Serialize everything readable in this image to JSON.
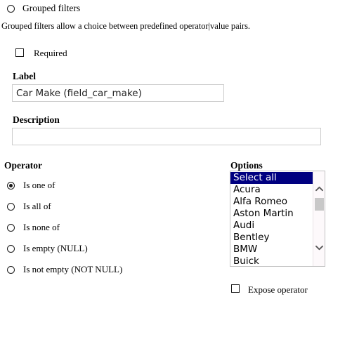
{
  "form": {
    "type_option": {
      "label": "Grouped filters",
      "selected": false,
      "icon": "radio-icon"
    },
    "help_text": "Grouped filters allow a choice between predefined operator|value pairs.",
    "required": {
      "label": "Required",
      "checked": false,
      "icon": "checkbox-icon"
    },
    "label_field": {
      "label": "Label",
      "value": "Car Make (field_car_make)",
      "placeholder": ""
    },
    "description_field": {
      "label": "Description",
      "value": "",
      "placeholder": ""
    },
    "operator": {
      "label": "Operator",
      "selected_index": 0,
      "options": [
        {
          "label": "Is one of"
        },
        {
          "label": "Is all of"
        },
        {
          "label": "Is none of"
        },
        {
          "label": "Is empty (NULL)"
        },
        {
          "label": "Is not empty (NOT NULL)"
        }
      ]
    },
    "options_list": {
      "label": "Options",
      "selected_index": 0,
      "items": [
        {
          "label": "Select all"
        },
        {
          "label": "Acura"
        },
        {
          "label": "Alfa Romeo"
        },
        {
          "label": "Aston Martin"
        },
        {
          "label": "Audi"
        },
        {
          "label": "Bentley"
        },
        {
          "label": "BMW"
        },
        {
          "label": "Buick"
        }
      ],
      "scrollbar": {
        "up_icon": "chevron-up-icon",
        "down_icon": "chevron-down-icon"
      }
    },
    "expose_operator": {
      "label": "Expose operator",
      "checked": false,
      "icon": "checkbox-icon"
    }
  },
  "colors": {
    "selection_bg": "#000080",
    "selection_fg": "#ffffff",
    "input_border": "#cccccc",
    "listbox_border": "#c2c2c2",
    "scroll_thumb": "#c8c8c8"
  }
}
